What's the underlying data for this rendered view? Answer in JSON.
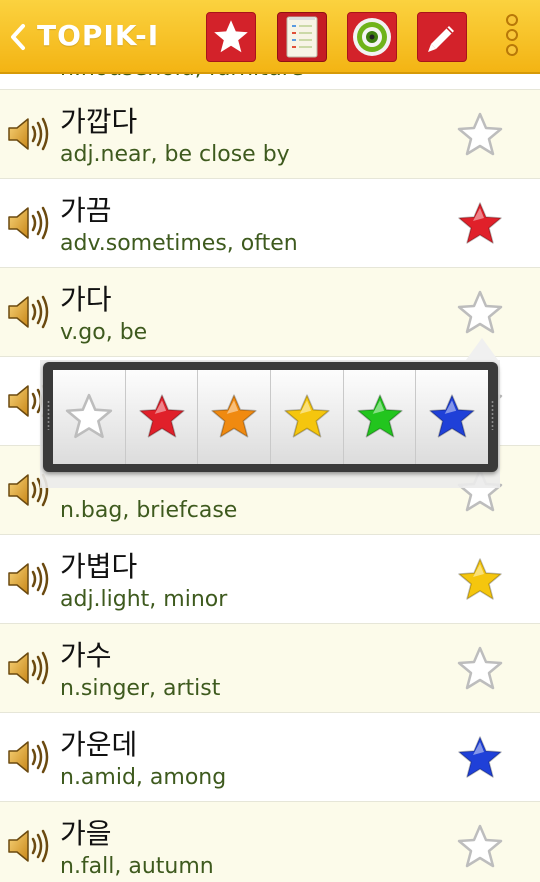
{
  "app": {
    "title": "TOPIK-I"
  },
  "toolbar": {
    "buttons": [
      {
        "name": "favorites",
        "icon": "star-icon"
      },
      {
        "name": "word-list",
        "icon": "checklist-icon"
      },
      {
        "name": "target",
        "icon": "target-icon"
      },
      {
        "name": "edit",
        "icon": "pencil-icon"
      }
    ],
    "overflow_icon": "overflow-menu-icon"
  },
  "partial_row": {
    "meaning": "n.household, furniture"
  },
  "words": [
    {
      "word": "가깝다",
      "meaning": "adj.near, be close by",
      "star": "none"
    },
    {
      "word": "가끔",
      "meaning": "adv.sometimes, often",
      "star": "red"
    },
    {
      "word": "가다",
      "meaning": "v.go, be",
      "star": "none"
    },
    {
      "word": "",
      "meaning": "",
      "star": "none"
    },
    {
      "word": "",
      "meaning": "n.bag, briefcase",
      "star": "none"
    },
    {
      "word": "가볍다",
      "meaning": "adj.light, minor",
      "star": "yellow"
    },
    {
      "word": "가수",
      "meaning": "n.singer, artist",
      "star": "none"
    },
    {
      "word": "가운데",
      "meaning": "n.amid, among",
      "star": "blue"
    },
    {
      "word": "가을",
      "meaning": "n.fall, autumn",
      "star": "none"
    }
  ],
  "star_picker": {
    "options": [
      "none",
      "red",
      "orange",
      "yellow",
      "green",
      "blue"
    ]
  },
  "colors": {
    "appbar": "#f5be22",
    "toolbar_button": "#d3222a",
    "meaning_text": "#3e5a1e",
    "row_alt": "#fcfbea",
    "star_red": "#e0202a",
    "star_orange": "#f08a10",
    "star_yellow": "#f5c60e",
    "star_green": "#22c51e",
    "star_blue": "#1f40d8",
    "star_none": "#bdbdbd"
  }
}
